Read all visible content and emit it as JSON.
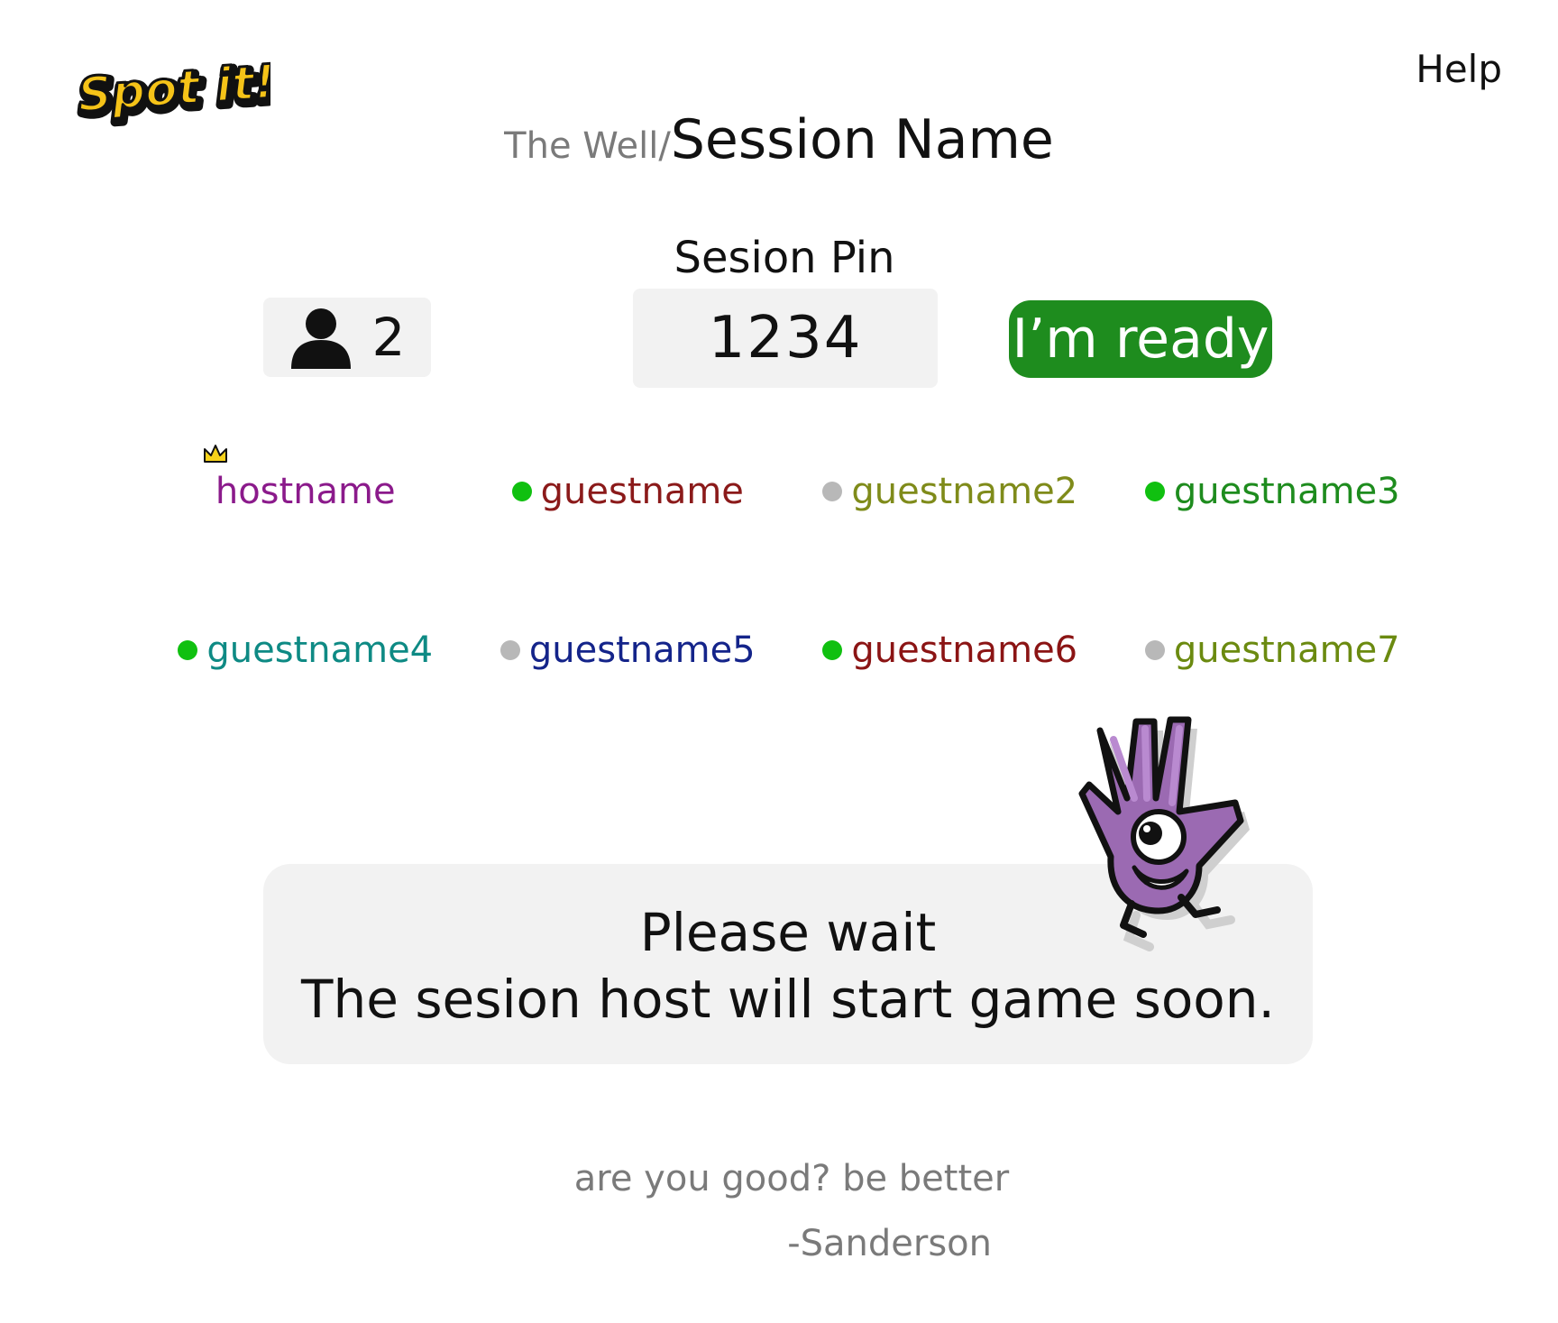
{
  "header": {
    "logo_text": "Spot it!",
    "help_label": "Help"
  },
  "breadcrumb": {
    "parent": "The Well",
    "separator": "/",
    "current": "Session Name"
  },
  "session": {
    "pin_label": "Sesion Pin",
    "pin_value": "1234",
    "player_count": "2",
    "ready_label": "I’m ready"
  },
  "players": [
    {
      "name": "hostname",
      "role": "host",
      "color": "#8b1a8b",
      "status": "none"
    },
    {
      "name": "guestname",
      "role": "guest",
      "color": "#8b1a1a",
      "status": "ready"
    },
    {
      "name": "guestname2",
      "role": "guest",
      "color": "#7f8b1a",
      "status": "waiting"
    },
    {
      "name": "guestname3",
      "role": "guest",
      "color": "#1e8c1e",
      "status": "ready"
    },
    {
      "name": "guestname4",
      "role": "guest",
      "color": "#0e8a84",
      "status": "ready"
    },
    {
      "name": "guestname5",
      "role": "guest",
      "color": "#14248a",
      "status": "waiting"
    },
    {
      "name": "guestname6",
      "role": "guest",
      "color": "#8b1414",
      "status": "ready"
    },
    {
      "name": "guestname7",
      "role": "guest",
      "color": "#6b8a10",
      "status": "waiting"
    }
  ],
  "status_colors": {
    "ready": "#10c010",
    "waiting": "#b8b8b8"
  },
  "wait_panel": {
    "title": "Please wait",
    "message": "The sesion host will start game soon."
  },
  "quote": {
    "text": "are you good? be better",
    "author": "-Sanderson"
  },
  "theme": {
    "accent": "#1e8c1e",
    "panel_bg": "#f2f2f2",
    "muted_text": "#7a7a7a"
  }
}
